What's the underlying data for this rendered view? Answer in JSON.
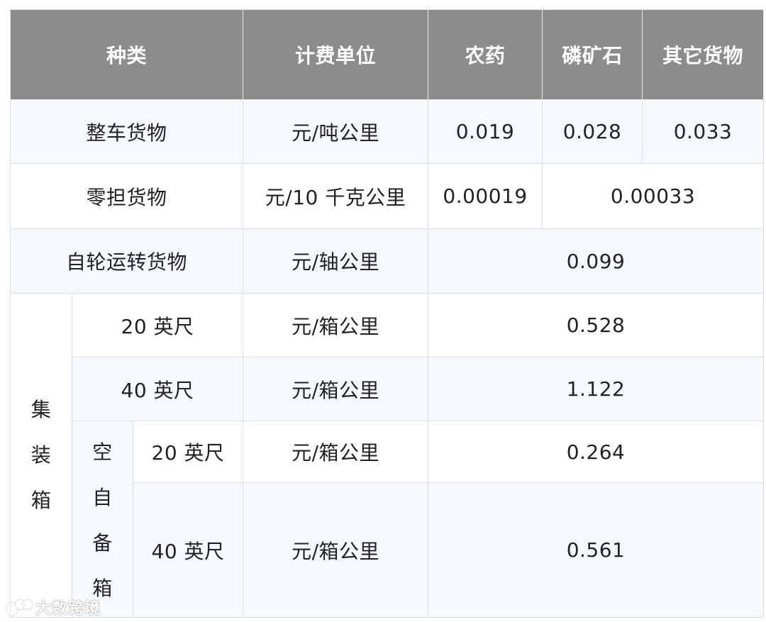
{
  "header": {
    "type": "种类",
    "unit": "计费单位",
    "pesticide": "农药",
    "phosphate": "磷矿石",
    "other": "其它货物"
  },
  "rows": {
    "full_car": {
      "label": "整车货物",
      "unit": "元/吨公里",
      "pesticide": "0.019",
      "phosphate": "0.028",
      "other": "0.033"
    },
    "less_than_carload": {
      "label": "零担货物",
      "unit": "元/10 千克公里",
      "pesticide": "0.00019",
      "rest": "0.00033"
    },
    "self_wheeled": {
      "label": "自轮运转货物",
      "unit": "元/轴公里",
      "value": "0.099"
    }
  },
  "container": {
    "label_chars": [
      "集",
      "装",
      "箱"
    ],
    "ft20": {
      "label": "20 英尺",
      "unit": "元/箱公里",
      "value": "0.528"
    },
    "ft40": {
      "label": "40 英尺",
      "unit": "元/箱公里",
      "value": "1.122"
    },
    "empty_own": {
      "label_chars": [
        "空",
        "自",
        "备",
        "箱"
      ],
      "ft20": {
        "label": "20 英尺",
        "unit": "元/箱公里",
        "value": "0.264"
      },
      "ft40": {
        "label": "40 英尺",
        "unit": "元/箱公里",
        "value": "0.561"
      }
    }
  },
  "watermark": {
    "text": "大数跨境",
    "icon": "brand-logo-icon"
  }
}
